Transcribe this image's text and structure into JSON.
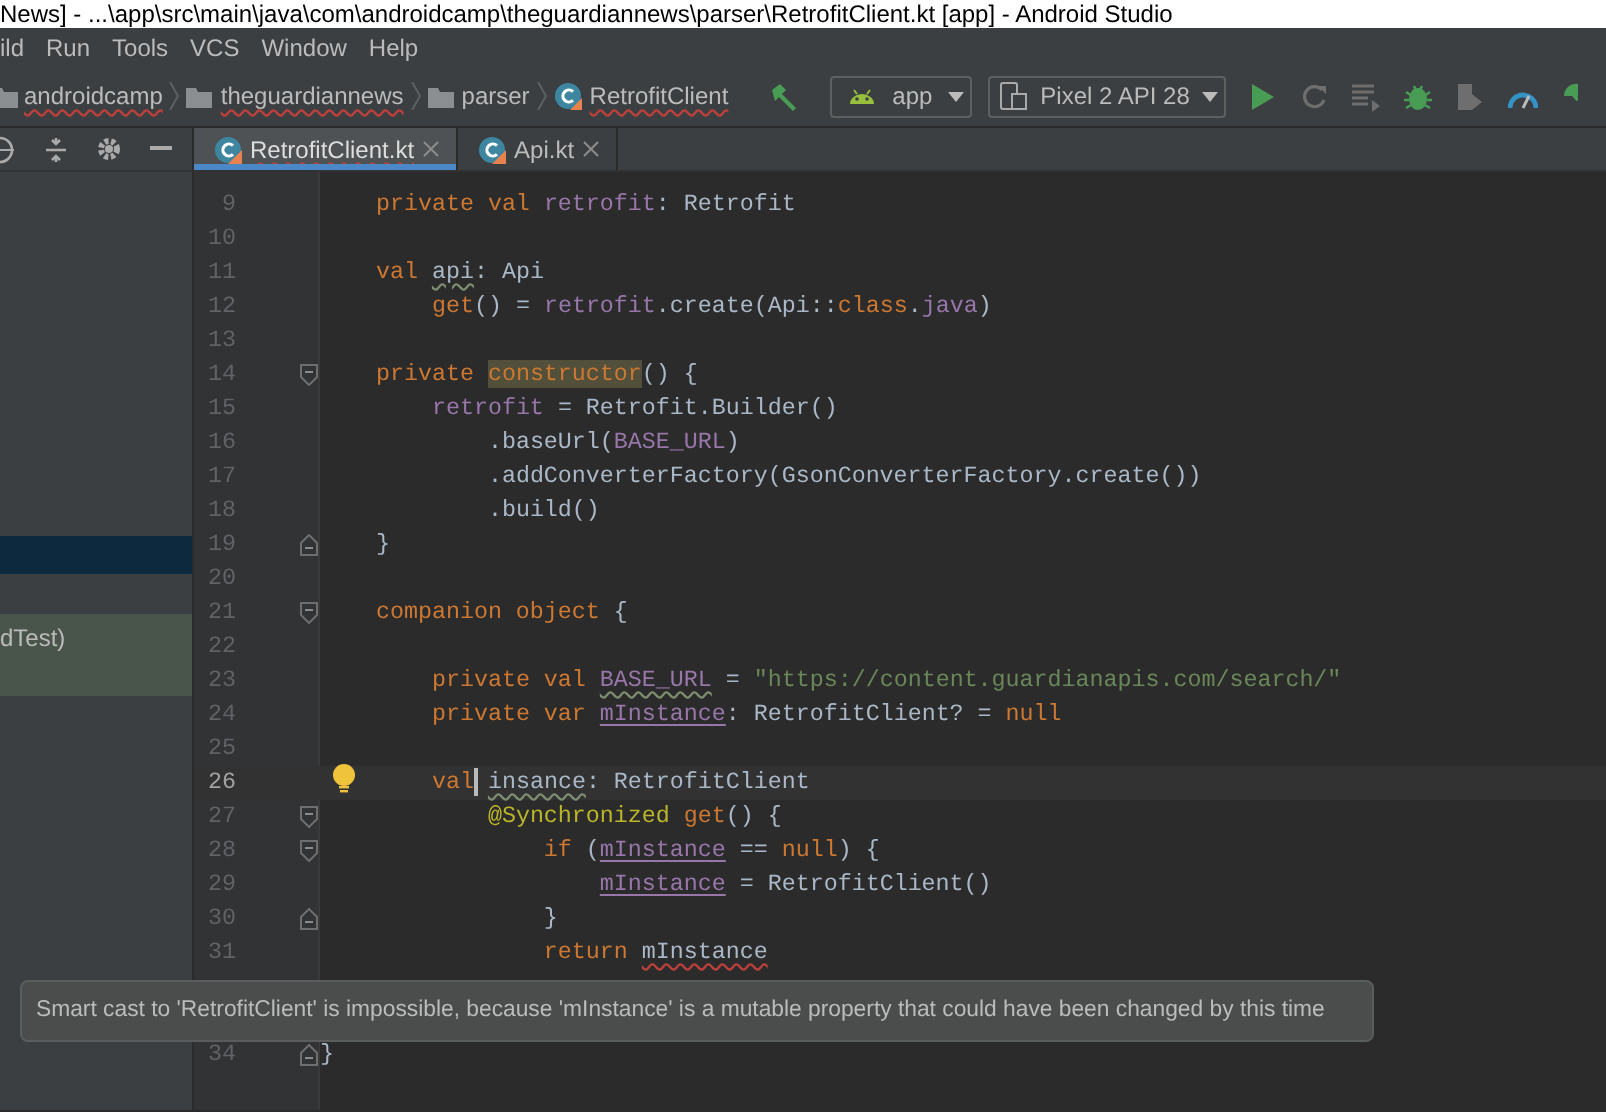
{
  "title_bar": {
    "title": "News] - ...\\app\\src\\main\\java\\com\\androidcamp\\theguardiannews\\parser\\RetrofitClient.kt [app] - Android Studio"
  },
  "menu_bar": {
    "items": [
      "ild",
      "Run",
      "Tools",
      "VCS",
      "Window",
      "Help"
    ]
  },
  "breadcrumbs": [
    {
      "label": "androidcamp",
      "kind": "folder",
      "typo": true
    },
    {
      "label": "theguardiannews",
      "kind": "folder",
      "typo": true
    },
    {
      "label": "parser",
      "kind": "folder",
      "typo": false
    },
    {
      "label": "RetrofitClient",
      "kind": "class",
      "typo": true
    }
  ],
  "toolbar": {
    "config": "app",
    "device": "Pixel 2 API 28"
  },
  "tabs": [
    {
      "label": "RetrofitClient.kt",
      "selected": true,
      "typo": true
    },
    {
      "label": "Api.kt",
      "selected": false,
      "typo": false
    }
  ],
  "project_panel": {
    "rows": [
      {
        "kind": "selected"
      },
      {
        "kind": "test",
        "label": "dTest)"
      }
    ]
  },
  "editor": {
    "lines": [
      {
        "number": "9",
        "current": false,
        "tokens": [
          {
            "text": "    private val ",
            "kind": "keyword"
          },
          {
            "text": "retrofit",
            "kind": "property"
          },
          {
            "text": ": Retrofit",
            "kind": "plain"
          }
        ]
      },
      {
        "number": "10",
        "current": false
      },
      {
        "number": "11",
        "current": false,
        "tokens": [
          {
            "text": "    val ",
            "kind": "keyword"
          },
          {
            "text": "api",
            "kind": "plain",
            "typo": true
          },
          {
            "text": ": Api",
            "kind": "plain"
          }
        ]
      },
      {
        "number": "12",
        "current": false,
        "tokens": [
          {
            "text": "        get",
            "kind": "keyword"
          },
          {
            "text": "() = ",
            "kind": "plain"
          },
          {
            "text": "retrofit",
            "kind": "property"
          },
          {
            "text": ".create(Api::",
            "kind": "plain"
          },
          {
            "text": "class",
            "kind": "keyword"
          },
          {
            "text": ".",
            "kind": "plain"
          },
          {
            "text": "java",
            "kind": "property"
          },
          {
            "text": ")",
            "kind": "plain"
          }
        ]
      },
      {
        "number": "13",
        "current": false
      },
      {
        "number": "14",
        "current": false,
        "fold_open": true,
        "tokens": [
          {
            "text": "    private ",
            "kind": "keyword"
          },
          {
            "text": "constructor",
            "kind": "keyword",
            "highlighted": true
          },
          {
            "text": "() {",
            "kind": "plain"
          }
        ]
      },
      {
        "number": "15",
        "current": false,
        "tokens": [
          {
            "text": "        retrofit",
            "kind": "property"
          },
          {
            "text": " = Retrofit.Builder()",
            "kind": "plain"
          }
        ]
      },
      {
        "number": "16",
        "current": false,
        "tokens": [
          {
            "text": "            .baseUrl(",
            "kind": "plain"
          },
          {
            "text": "BASE_URL",
            "kind": "property"
          },
          {
            "text": ")",
            "kind": "plain"
          }
        ]
      },
      {
        "number": "17",
        "current": false,
        "tokens": [
          {
            "text": "            .addConverterFactory(GsonConverterFactory.create())",
            "kind": "plain"
          }
        ]
      },
      {
        "number": "18",
        "current": false,
        "tokens": [
          {
            "text": "            .build()",
            "kind": "plain"
          }
        ]
      },
      {
        "number": "19",
        "current": false,
        "fold_close": true,
        "tokens": [
          {
            "text": "    }",
            "kind": "plain"
          }
        ]
      },
      {
        "number": "20",
        "current": false
      },
      {
        "number": "21",
        "current": false,
        "fold_open": true,
        "tokens": [
          {
            "text": "    companion object ",
            "kind": "keyword"
          },
          {
            "text": "{",
            "kind": "plain"
          }
        ]
      },
      {
        "number": "22",
        "current": false
      },
      {
        "number": "23",
        "current": false,
        "tokens": [
          {
            "text": "        private val ",
            "kind": "keyword"
          },
          {
            "text": "BASE_URL",
            "kind": "property",
            "typo": true
          },
          {
            "text": " = ",
            "kind": "plain"
          },
          {
            "text": "\"https://content.guardianapis.com/search/\"",
            "kind": "string"
          }
        ]
      },
      {
        "number": "24",
        "current": false,
        "tokens": [
          {
            "text": "        private var ",
            "kind": "keyword"
          },
          {
            "text": "mInstance",
            "kind": "property",
            "underlined": true
          },
          {
            "text": ": RetrofitClient? = ",
            "kind": "plain"
          },
          {
            "text": "null",
            "kind": "keyword"
          }
        ]
      },
      {
        "number": "25",
        "current": false
      },
      {
        "number": "26",
        "current": true,
        "bulb": true,
        "tokens": [
          {
            "text": "        val",
            "kind": "keyword",
            "caret": true
          },
          {
            "text": " insance",
            "kind": "plain",
            "typo": true
          },
          {
            "text": ": RetrofitClient",
            "kind": "plain"
          }
        ]
      },
      {
        "number": "27",
        "current": false,
        "fold_open": true,
        "tokens": [
          {
            "text": "            @Synchronized ",
            "kind": "annotation"
          },
          {
            "text": "get",
            "kind": "keyword"
          },
          {
            "text": "() {",
            "kind": "plain"
          }
        ]
      },
      {
        "number": "28",
        "current": false,
        "fold_open": true,
        "tokens": [
          {
            "text": "                if ",
            "kind": "keyword"
          },
          {
            "text": "(",
            "kind": "plain"
          },
          {
            "text": "mInstance",
            "kind": "property",
            "underlined": true
          },
          {
            "text": " == ",
            "kind": "plain"
          },
          {
            "text": "null",
            "kind": "keyword"
          },
          {
            "text": ") {",
            "kind": "plain"
          }
        ]
      },
      {
        "number": "29",
        "current": false,
        "tokens": [
          {
            "text": "                    mInstance",
            "kind": "property",
            "underlined": true
          },
          {
            "text": " = RetrofitClient()",
            "kind": "plain"
          }
        ]
      },
      {
        "number": "30",
        "current": false,
        "fold_close": true,
        "tokens": [
          {
            "text": "                }",
            "kind": "plain"
          }
        ]
      },
      {
        "number": "31",
        "current": false,
        "tokens": [
          {
            "text": "                return ",
            "kind": "keyword"
          },
          {
            "text": "mInstance",
            "kind": "plain",
            "error": true
          }
        ]
      }
    ],
    "tail_lines": [
      {
        "number": "34",
        "current": false,
        "fold_close": true,
        "tokens": [
          {
            "text": "}",
            "kind": "plain"
          }
        ]
      }
    ]
  },
  "tooltip": {
    "text": "Smart cast to 'RetrofitClient' is impossible, because 'mInstance' is a mutable property that could have been changed by this time"
  }
}
